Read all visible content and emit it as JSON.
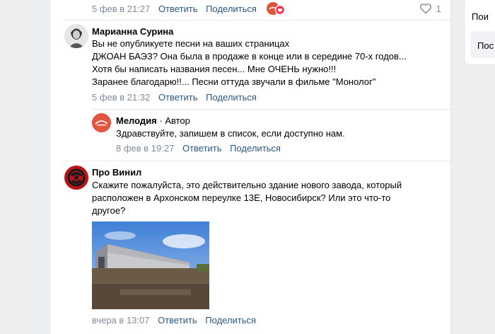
{
  "top_comment": {
    "date": "5 фев в 21:27",
    "reply_label": "Ответить",
    "share_label": "Поделиться",
    "like_count": "1",
    "heart_icon": "heart-icon"
  },
  "right_panel": {
    "item1": "Пои",
    "item2": "Пос"
  },
  "comment1": {
    "author": "Марианна Сурина",
    "lines": [
      "Вы не опубликуете песни на ваших страницах",
      "ДЖОАН БАЭЗ? Она была в продаже в конце или в середине 70-х годов...",
      "Хотя бы написать названия песен... Мне ОЧЕНЬ нужно!!!",
      "Заранее благодарю!!... Песни оттуда звучали в фильме \"Монолог\""
    ],
    "date": "5 фев в 21:32",
    "reply_label": "Ответить",
    "share_label": "Поделиться"
  },
  "reply1": {
    "author": "Мелодия",
    "author_role": "· Автор",
    "text": "Здравствуйте, запишем в список, если доступно нам.",
    "date": "8 фев в 19:27",
    "reply_label": "Ответить",
    "share_label": "Поделиться"
  },
  "comment2": {
    "author": "Про Винил",
    "lines": [
      "Скажите пожалуйста, это действительно здание нового завода, который",
      "расположен в Архонском переулке 13Е, Новосибирск? Или это что-то",
      "другое?"
    ],
    "date": "вчера в 13:07",
    "reply_label": "Ответить",
    "share_label": "Поделиться"
  },
  "colors": {
    "link": "#2a5885",
    "meta": "#818c99",
    "background": "#edeef0"
  }
}
